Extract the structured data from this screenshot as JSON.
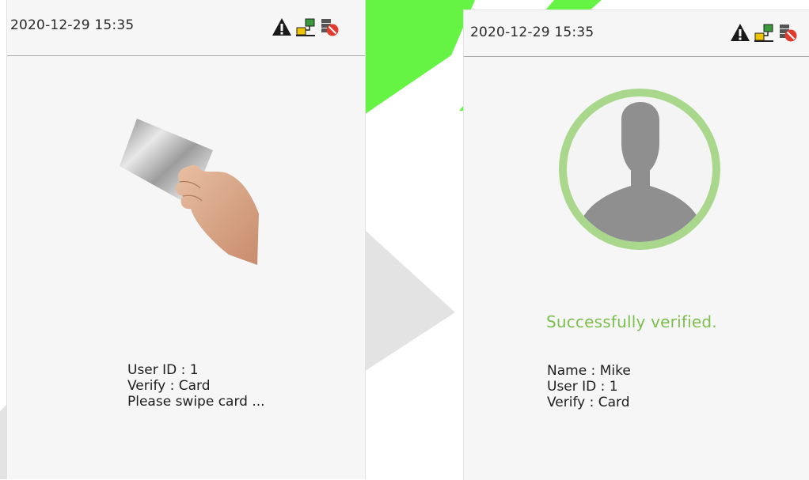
{
  "left_screen": {
    "datetime": "2020-12-29 15:35",
    "icons": [
      "warning-icon",
      "network-icon",
      "server-alert-icon"
    ],
    "user_id_line": "User ID : 1",
    "verify_line": "Verify : Card",
    "prompt_line": "Please swipe card ..."
  },
  "right_screen": {
    "datetime": "2020-12-29 15:35",
    "icons": [
      "warning-icon",
      "network-icon",
      "server-alert-icon"
    ],
    "success_message": "Successfully verified.",
    "name_line": "Name : Mike",
    "user_id_line": "User ID : 1",
    "verify_line": "Verify : Card"
  },
  "colors": {
    "success_text": "#7bbf4c",
    "avatar_ring": "#a9d88c",
    "watermark_green": "#5df23a",
    "watermark_gray": "#e3e3e3"
  }
}
